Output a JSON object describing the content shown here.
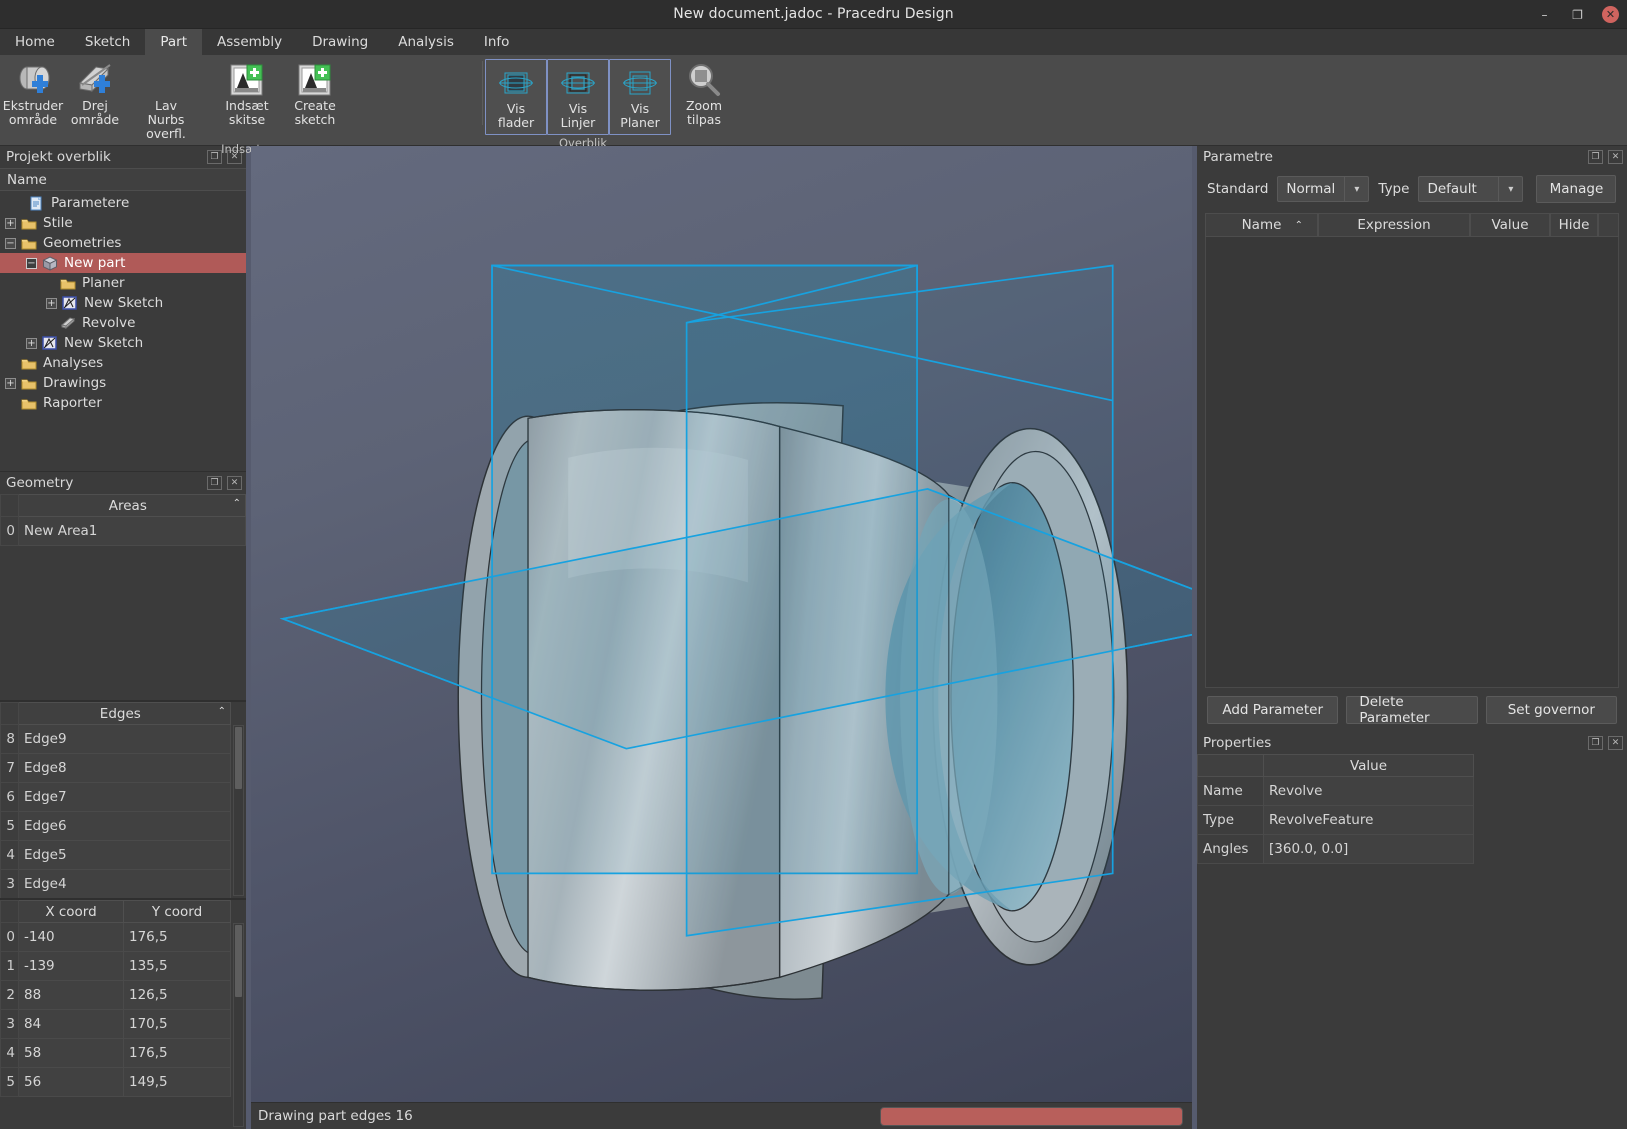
{
  "window": {
    "title": "New document.jadoc - Pracedru Design",
    "minimize": "–",
    "maximize": "❐",
    "close": "✕"
  },
  "menu": {
    "tabs": [
      {
        "label": "Home",
        "active": false
      },
      {
        "label": "Sketch",
        "active": false
      },
      {
        "label": "Part",
        "active": true
      },
      {
        "label": "Assembly",
        "active": false
      },
      {
        "label": "Drawing",
        "active": false
      },
      {
        "label": "Analysis",
        "active": false
      },
      {
        "label": "Info",
        "active": false
      }
    ]
  },
  "ribbon": {
    "groups": [
      {
        "label": "Indsæt",
        "buttons": [
          {
            "label": "Ekstruder\nområde",
            "l1": "Ekstruder",
            "l2": "område",
            "icon": "extrude-area-icon"
          },
          {
            "label": "Drej område",
            "l1": "Drej",
            "l2": "område",
            "icon": "revolve-area-icon"
          },
          {
            "label": "Lav Nurbs overfl.",
            "l1": "Lav Nurbs",
            "l2": "overfl.",
            "icon": "nurbs-surface-icon"
          },
          {
            "label": "Indsæt skitse",
            "l1": "Indsæt",
            "l2": "skitse",
            "icon": "insert-sketch-icon"
          },
          {
            "label": "Create sketch",
            "l1": "Create",
            "l2": "sketch",
            "icon": "create-sketch-icon"
          }
        ]
      },
      {
        "label": "Overblik",
        "buttons": [
          {
            "label": "Vis flader",
            "l1": "Vis",
            "l2": "flader",
            "icon": "show-faces-icon",
            "toggled": true
          },
          {
            "label": "Vis Linjer",
            "l1": "Vis",
            "l2": "Linjer",
            "icon": "show-lines-icon",
            "toggled": true
          },
          {
            "label": "Vis Planer",
            "l1": "Vis",
            "l2": "Planer",
            "icon": "show-planes-icon",
            "toggled": true
          },
          {
            "label": "Zoom tilpas",
            "l1": "Zoom",
            "l2": "tilpas",
            "icon": "zoom-fit-icon",
            "toggled": false
          }
        ]
      }
    ]
  },
  "project_panel": {
    "title": "Projekt overblik",
    "column_header": "Name",
    "float_icon": "❐",
    "close_icon": "✕",
    "tree": [
      {
        "label": "Parametere",
        "depth": 1,
        "expander": "",
        "icon": "parameters-doc-icon",
        "selected": false
      },
      {
        "label": "Stile",
        "depth": 0,
        "expander": "+",
        "icon": "folder-icon",
        "selected": false
      },
      {
        "label": "Geometries",
        "depth": 0,
        "expander": "−",
        "icon": "folder-open-icon",
        "selected": false
      },
      {
        "label": "New part",
        "depth": 1,
        "expander": "−",
        "icon": "part-cube-icon",
        "selected": true
      },
      {
        "label": "Planer",
        "depth": 2,
        "expander": "",
        "icon": "folder-icon",
        "selected": false
      },
      {
        "label": "New Sketch",
        "depth": 2,
        "expander": "+",
        "icon": "sketch-icon",
        "selected": false
      },
      {
        "label": "Revolve",
        "depth": 2,
        "expander": "",
        "icon": "revolve-feature-icon",
        "selected": false
      },
      {
        "label": "New Sketch",
        "depth": 1,
        "expander": "+",
        "icon": "sketch-icon",
        "selected": false
      },
      {
        "label": "Analyses",
        "depth": 1,
        "expander": "",
        "icon": "folder-icon",
        "selected": false
      },
      {
        "label": "Drawings",
        "depth": 0,
        "expander": "+",
        "icon": "folder-icon",
        "selected": false
      },
      {
        "label": "Raporter",
        "depth": 1,
        "expander": "",
        "icon": "folder-icon",
        "selected": false
      }
    ]
  },
  "geometry_panel": {
    "title": "Geometry",
    "float_icon": "❐",
    "close_icon": "✕",
    "areas": {
      "header": "Areas",
      "sort_indicator": "⌃",
      "rows": [
        {
          "index": "0",
          "name": "New Area1"
        }
      ]
    },
    "edges": {
      "header": "Edges",
      "sort_indicator": "⌃",
      "rows": [
        {
          "index": "8",
          "name": "Edge9"
        },
        {
          "index": "7",
          "name": "Edge8"
        },
        {
          "index": "6",
          "name": "Edge7"
        },
        {
          "index": "5",
          "name": "Edge6"
        },
        {
          "index": "4",
          "name": "Edge5"
        },
        {
          "index": "3",
          "name": "Edge4"
        }
      ]
    },
    "coords": {
      "headers": [
        "X coord",
        "Y coord"
      ],
      "rows": [
        {
          "index": "0",
          "x": "-140",
          "y": "176,5"
        },
        {
          "index": "1",
          "x": "-139",
          "y": "135,5"
        },
        {
          "index": "2",
          "x": "88",
          "y": "126,5"
        },
        {
          "index": "3",
          "x": "84",
          "y": "170,5"
        },
        {
          "index": "4",
          "x": "58",
          "y": "176,5"
        },
        {
          "index": "5",
          "x": "56",
          "y": "149,5"
        }
      ]
    }
  },
  "parameters_panel": {
    "title": "Parametre",
    "float_icon": "❐",
    "close_icon": "✕",
    "standard_label": "Standard",
    "standard_value": "Normal",
    "type_label": "Type",
    "type_value": "Default",
    "manage_button": "Manage",
    "columns": [
      "Name",
      "Expression",
      "Value",
      "Hide"
    ],
    "sort_indicator": "⌃",
    "rows": [],
    "buttons": [
      "Add Parameter",
      "Delete Parameter",
      "Set governor"
    ]
  },
  "properties_panel": {
    "title": "Properties",
    "float_icon": "❐",
    "close_icon": "✕",
    "value_header": "Value",
    "rows": [
      {
        "key": "Name",
        "value": "Revolve"
      },
      {
        "key": "Type",
        "value": "RevolveFeature"
      },
      {
        "key": "Angles",
        "value": "[360.0, 0.0]"
      }
    ]
  },
  "statusbar": {
    "message": "Drawing part edges 16",
    "progress_color": "#b85f5b"
  },
  "viewport": {
    "model_name": "Revolve",
    "plane_color": "#1f9fdc",
    "background_top": "#646a7e",
    "background_bottom": "#3e4356"
  }
}
